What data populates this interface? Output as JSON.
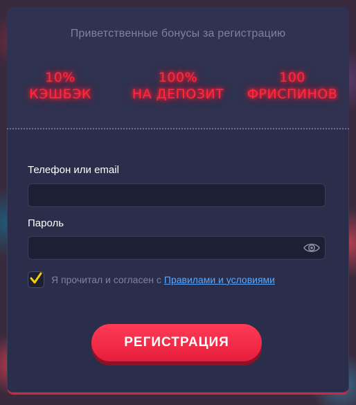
{
  "header": {
    "subtitle": "Приветственные бонусы за регистрацию"
  },
  "bonuses": [
    {
      "value": "10%",
      "label": "КЭШБЭК"
    },
    {
      "value": "100%",
      "label": "НА ДЕПОЗИТ"
    },
    {
      "value": "100",
      "label": "ФРИСПИНОВ"
    }
  ],
  "form": {
    "phone_label": "Телефон или email",
    "phone_value": "",
    "password_label": "Пароль",
    "password_value": "",
    "agree_text": "Я прочитал и согласен с",
    "agree_link": "Правилами и условиями",
    "agree_checked": true,
    "submit_label": "РЕГИСТРАЦИЯ"
  },
  "colors": {
    "accent": "#ff2a3d",
    "panel": "#2b2e4b",
    "checkmark": "#f5d000",
    "link": "#5aa9ff"
  }
}
